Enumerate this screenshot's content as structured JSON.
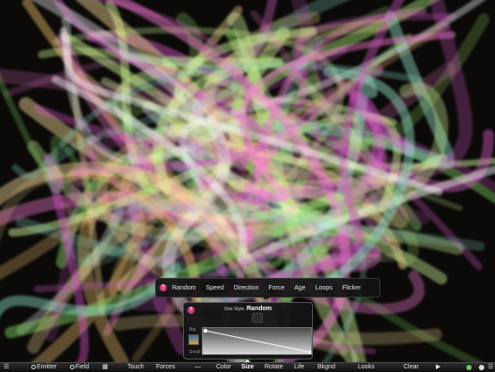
{
  "mode_menu": {
    "help_icon": "?",
    "options": [
      "Random",
      "Speed",
      "Direction",
      "Force",
      "Age",
      "Loops",
      "Flicker"
    ],
    "selected": "Random"
  },
  "size_panel": {
    "help_icon": "?",
    "title_prefix": "Size Style:",
    "title_value": "Random",
    "label_big": "Big",
    "label_small": "Small"
  },
  "toolbar": {
    "menu_icon": "☰",
    "emitter": "Emitter",
    "field": "Field",
    "grid_icon": "grid-icon",
    "touch": "Touch",
    "forces": "Forces",
    "dash": "—",
    "color": "Color",
    "size": "Size",
    "rotate": "Rotate",
    "life": "Life",
    "bkgnd": "Bkgnd",
    "looks": "Looks",
    "clear": "Clear",
    "play_icon": "▶",
    "more_icon": "☰",
    "active_tab": "Size"
  },
  "colors": {
    "accent_help": "#d1397a",
    "status_green": "#5fd04a"
  }
}
